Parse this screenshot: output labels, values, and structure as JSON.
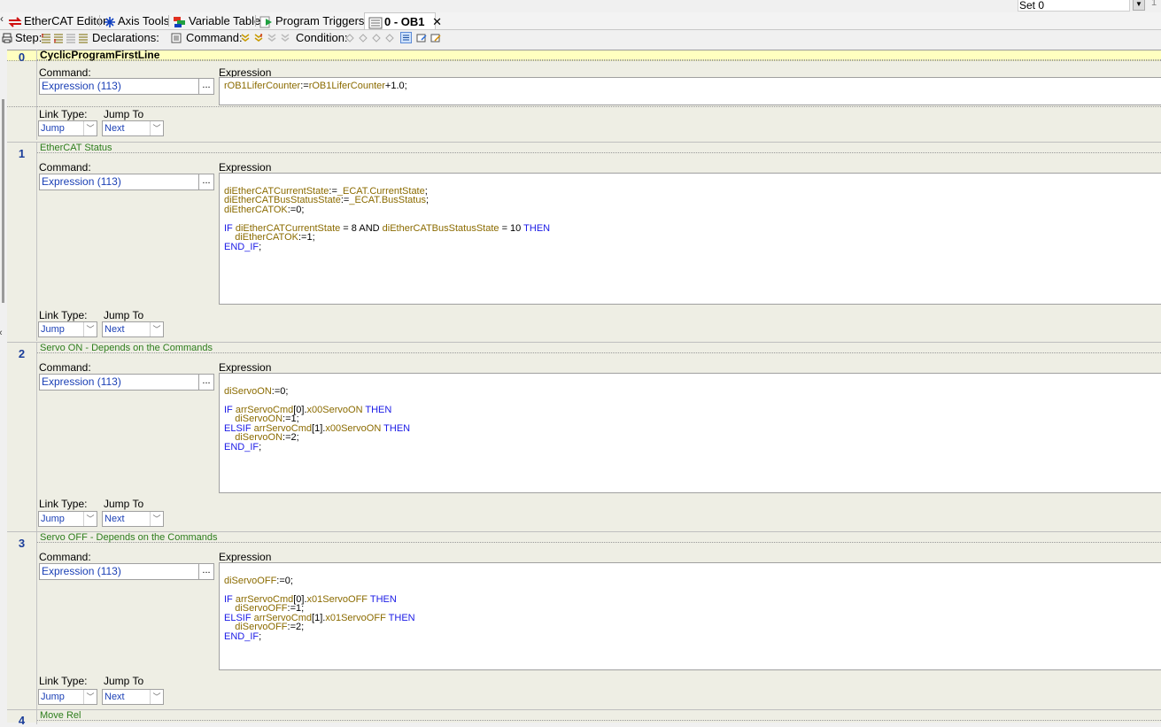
{
  "set_selector": {
    "value": "Set 0",
    "counter": "1"
  },
  "tabs": [
    {
      "label": "EtherCAT Editor",
      "icon": "ethercat-icon"
    },
    {
      "label": "Axis Tools",
      "icon": "axis-tools-icon"
    },
    {
      "label": "Variable Table",
      "icon": "variable-table-icon"
    },
    {
      "label": "Program Triggers",
      "icon": "program-triggers-icon"
    },
    {
      "label": "0 - OB1",
      "icon": "ob1-program-icon",
      "active": true
    }
  ],
  "toolbar": {
    "step_label": "Step:",
    "declarations_label": "Declarations:",
    "command_label": "Command:",
    "condition_label": "Condition:"
  },
  "labels": {
    "command": "Command:",
    "expression": "Expression",
    "link_type": "Link Type:",
    "jump_to": "Jump To"
  },
  "steps": [
    {
      "num": "0",
      "name": "CyclicProgramFirstLine",
      "command": "Expression (113)",
      "link_type": "Jump",
      "jump_to": "Next",
      "code": [
        [
          {
            "t": "rOB1LiferCounter",
            "c": "var"
          },
          {
            "t": ":=",
            "c": ""
          },
          {
            "t": "rOB1LiferCounter",
            "c": "var"
          },
          {
            "t": "+1.0;",
            "c": ""
          }
        ]
      ]
    },
    {
      "num": "1",
      "name": "EtherCAT Status",
      "command": "Expression (113)",
      "link_type": "Jump",
      "jump_to": "Next",
      "code": [
        [],
        [
          {
            "t": "diEtherCATCurrentState",
            "c": "var"
          },
          {
            "t": ":=",
            "c": ""
          },
          {
            "t": "_ECAT.CurrentState",
            "c": "var"
          },
          {
            "t": ";",
            "c": ""
          }
        ],
        [
          {
            "t": "diEtherCATBusStatusState",
            "c": "var"
          },
          {
            "t": ":=",
            "c": ""
          },
          {
            "t": "_ECAT.BusStatus",
            "c": "var"
          },
          {
            "t": ";",
            "c": ""
          }
        ],
        [
          {
            "t": "diEtherCATOK",
            "c": "var"
          },
          {
            "t": ":=0;",
            "c": ""
          }
        ],
        [],
        [
          {
            "t": "IF ",
            "c": "kw"
          },
          {
            "t": "diEtherCATCurrentState",
            "c": "var"
          },
          {
            "t": " = 8 AND ",
            "c": ""
          },
          {
            "t": "diEtherCATBusStatusState",
            "c": "var"
          },
          {
            "t": " = 10 ",
            "c": ""
          },
          {
            "t": "THEN",
            "c": "kw"
          }
        ],
        [
          {
            "t": "    ",
            "c": ""
          },
          {
            "t": "diEtherCATOK",
            "c": "var"
          },
          {
            "t": ":=1;",
            "c": ""
          }
        ],
        [
          {
            "t": "END_IF",
            "c": "kw"
          },
          {
            "t": ";",
            "c": ""
          }
        ]
      ]
    },
    {
      "num": "2",
      "name": "Servo ON - Depends on the Commands",
      "command": "Expression (113)",
      "link_type": "Jump",
      "jump_to": "Next",
      "code": [
        [],
        [
          {
            "t": "diServoON",
            "c": "var"
          },
          {
            "t": ":=0;",
            "c": ""
          }
        ],
        [],
        [
          {
            "t": "IF ",
            "c": "kw"
          },
          {
            "t": "arrServoCmd",
            "c": "var"
          },
          {
            "t": "[0].",
            "c": ""
          },
          {
            "t": "x00ServoON",
            "c": "var"
          },
          {
            "t": " THEN",
            "c": "kw"
          }
        ],
        [
          {
            "t": "    ",
            "c": ""
          },
          {
            "t": "diServoON",
            "c": "var"
          },
          {
            "t": ":=1;",
            "c": ""
          }
        ],
        [
          {
            "t": "ELSIF ",
            "c": "kw"
          },
          {
            "t": "arrServoCmd",
            "c": "var"
          },
          {
            "t": "[1].",
            "c": ""
          },
          {
            "t": "x00ServoON",
            "c": "var"
          },
          {
            "t": " THEN",
            "c": "kw"
          }
        ],
        [
          {
            "t": "    ",
            "c": ""
          },
          {
            "t": "diServoON",
            "c": "var"
          },
          {
            "t": ":=2;",
            "c": ""
          }
        ],
        [
          {
            "t": "END_IF",
            "c": "kw"
          },
          {
            "t": ";",
            "c": ""
          }
        ]
      ]
    },
    {
      "num": "3",
      "name": "Servo OFF - Depends on the Commands",
      "command": "Expression (113)",
      "link_type": "Jump",
      "jump_to": "Next",
      "code": [
        [],
        [
          {
            "t": "diServoOFF",
            "c": "var"
          },
          {
            "t": ":=0;",
            "c": ""
          }
        ],
        [],
        [
          {
            "t": "IF ",
            "c": "kw"
          },
          {
            "t": "arrServoCmd",
            "c": "var"
          },
          {
            "t": "[0].",
            "c": ""
          },
          {
            "t": "x01ServoOFF",
            "c": "var"
          },
          {
            "t": " THEN",
            "c": "kw"
          }
        ],
        [
          {
            "t": "    ",
            "c": ""
          },
          {
            "t": "diServoOFF",
            "c": "var"
          },
          {
            "t": ":=1;",
            "c": ""
          }
        ],
        [
          {
            "t": "ELSIF ",
            "c": "kw"
          },
          {
            "t": "arrServoCmd",
            "c": "var"
          },
          {
            "t": "[1].",
            "c": ""
          },
          {
            "t": "x01ServoOFF",
            "c": "var"
          },
          {
            "t": " THEN",
            "c": "kw"
          }
        ],
        [
          {
            "t": "    ",
            "c": ""
          },
          {
            "t": "diServoOFF",
            "c": "var"
          },
          {
            "t": ":=2;",
            "c": ""
          }
        ],
        [
          {
            "t": "END_IF",
            "c": "kw"
          },
          {
            "t": ";",
            "c": ""
          }
        ]
      ]
    },
    {
      "num": "4",
      "name": "Move Rel"
    }
  ],
  "colors": {
    "step0_header_bg": "#ffffc0",
    "step_name_green": "#2d7d1c",
    "step_num_blue": "#1a3d99",
    "keyword_blue": "#1a1ae6",
    "variable_brown": "#8b6b00",
    "grid_bg": "#eeeee4"
  }
}
